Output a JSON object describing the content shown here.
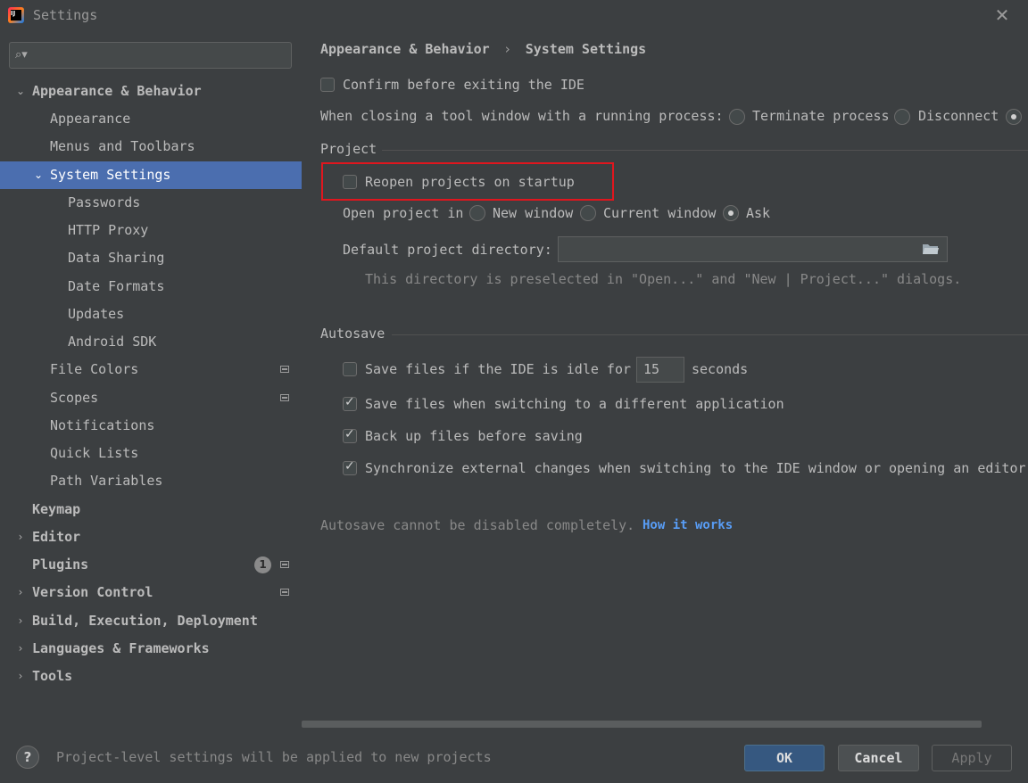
{
  "window": {
    "title": "Settings",
    "app_icon_text": "IJ"
  },
  "sidebar": {
    "search": {
      "value": "",
      "placeholder": ""
    },
    "items": [
      {
        "label": "Appearance & Behavior",
        "expanded": true
      },
      {
        "label": "Appearance"
      },
      {
        "label": "Menus and Toolbars"
      },
      {
        "label": "System Settings",
        "expanded": true,
        "selected": true
      },
      {
        "label": "Passwords"
      },
      {
        "label": "HTTP Proxy"
      },
      {
        "label": "Data Sharing"
      },
      {
        "label": "Date Formats"
      },
      {
        "label": "Updates"
      },
      {
        "label": "Android SDK"
      },
      {
        "label": "File Colors"
      },
      {
        "label": "Scopes"
      },
      {
        "label": "Notifications"
      },
      {
        "label": "Quick Lists"
      },
      {
        "label": "Path Variables"
      },
      {
        "label": "Keymap"
      },
      {
        "label": "Editor"
      },
      {
        "label": "Plugins",
        "badge": "1"
      },
      {
        "label": "Version Control"
      },
      {
        "label": "Build, Execution, Deployment"
      },
      {
        "label": "Languages & Frameworks"
      },
      {
        "label": "Tools"
      }
    ]
  },
  "content": {
    "breadcrumb": {
      "parent": "Appearance & Behavior",
      "separator": "›",
      "current": "System Settings"
    },
    "confirm_exit": {
      "label": "Confirm before exiting the IDE",
      "checked": false
    },
    "closing_tool_window": {
      "label": "When closing a tool window with a running process:",
      "options": [
        {
          "label": "Terminate process",
          "selected": false
        },
        {
          "label": "Disconnect",
          "selected": false
        },
        {
          "label": "",
          "selected": true
        }
      ]
    },
    "project": {
      "title": "Project",
      "reopen": {
        "label": "Reopen projects on startup",
        "checked": false
      },
      "open_in": {
        "label": "Open project in",
        "options": [
          {
            "label": "New window",
            "selected": false
          },
          {
            "label": "Current window",
            "selected": false
          },
          {
            "label": "Ask",
            "selected": true
          }
        ]
      },
      "default_dir": {
        "label": "Default project directory:",
        "value": "",
        "hint": "This directory is preselected in \"Open...\" and \"New | Project...\" dialogs."
      }
    },
    "autosave": {
      "title": "Autosave",
      "idle": {
        "label": "Save files if the IDE is idle for",
        "checked": false,
        "value": "15",
        "unit": "seconds"
      },
      "switching": {
        "label": "Save files when switching to a different application",
        "checked": true
      },
      "backup": {
        "label": "Back up files before saving",
        "checked": true
      },
      "sync": {
        "label": "Synchronize external changes when switching to the IDE window or opening an editor",
        "checked": true
      },
      "note": "Autosave cannot be disabled completely.",
      "link": "How it works"
    }
  },
  "footer": {
    "help": "?",
    "message": "Project-level settings will be applied to new projects",
    "ok": "OK",
    "cancel": "Cancel",
    "apply": "Apply"
  },
  "colors": {
    "background": "#3c3f41",
    "selection": "#4b6eaf",
    "highlight_box": "#e0161e",
    "link": "#589df6",
    "ok_button": "#365880"
  }
}
